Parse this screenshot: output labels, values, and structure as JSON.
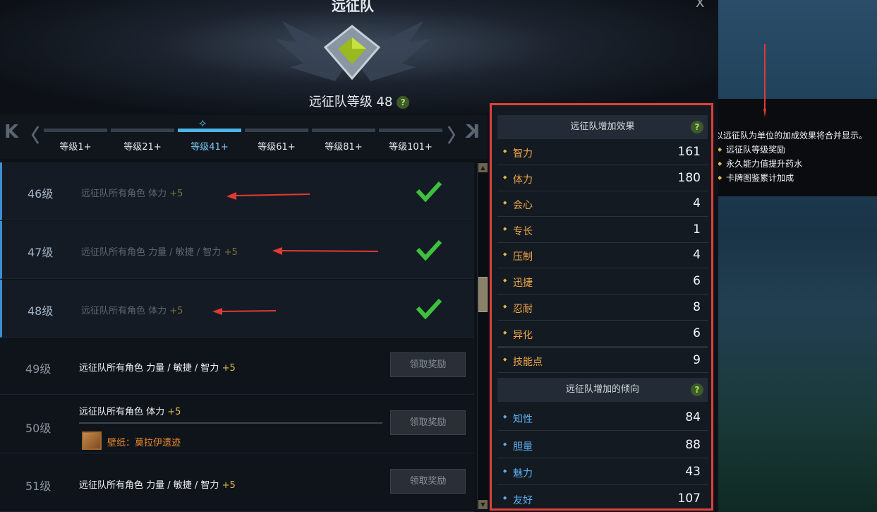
{
  "window": {
    "title": "远征队",
    "close_label": "X"
  },
  "header": {
    "level_text": "远征队等级 48",
    "help": "?"
  },
  "tabs": {
    "first_label": "K",
    "prev_label": "〈",
    "next_label": "〉",
    "last_label": "K",
    "items": [
      {
        "label": "等级1+"
      },
      {
        "label": "等级21+"
      },
      {
        "label": "等级41+"
      },
      {
        "label": "等级61+"
      },
      {
        "label": "等级81+"
      },
      {
        "label": "等级101+"
      }
    ],
    "active_index": 2
  },
  "rows": [
    {
      "level": "46级",
      "desc": "远征队所有角色 体力",
      "bonus": "+5",
      "status": "done"
    },
    {
      "level": "47级",
      "desc": "远征队所有角色 力量 / 敏捷 / 智力",
      "bonus": "+5",
      "status": "done"
    },
    {
      "level": "48级",
      "desc": "远征队所有角色 体力",
      "bonus": "+5",
      "status": "done"
    },
    {
      "level": "49级",
      "desc": "远征队所有角色 力量 / 敏捷 / 智力",
      "bonus": "+5",
      "status": "pending",
      "button": "领取奖励"
    },
    {
      "level": "50级",
      "desc": "远征队所有角色 体力",
      "bonus": "+5",
      "status": "pending",
      "button": "领取奖励",
      "reward": "壁纸：莫拉伊遗迹"
    },
    {
      "level": "51级",
      "desc": "远征队所有角色 力量 / 敏捷 / 智力",
      "bonus": "+5",
      "status": "pending",
      "button": "领取奖励"
    }
  ],
  "effects": {
    "title": "远征队增加效果",
    "help": "?",
    "stats": [
      {
        "name": "智力",
        "value": "161"
      },
      {
        "name": "体力",
        "value": "180"
      },
      {
        "name": "会心",
        "value": "4"
      },
      {
        "name": "专长",
        "value": "1"
      },
      {
        "name": "压制",
        "value": "4"
      },
      {
        "name": "迅捷",
        "value": "6"
      },
      {
        "name": "忍耐",
        "value": "8"
      },
      {
        "name": "异化",
        "value": "6"
      },
      {
        "name": "技能点",
        "value": "9"
      }
    ]
  },
  "tendency": {
    "title": "远征队增加的倾向",
    "help": "?",
    "stats": [
      {
        "name": "知性",
        "value": "84"
      },
      {
        "name": "胆量",
        "value": "88"
      },
      {
        "name": "魅力",
        "value": "43"
      },
      {
        "name": "友好",
        "value": "107"
      }
    ]
  },
  "tooltip": {
    "line1": "以远征队为单位的加成效果将合并显示。",
    "bullets": [
      "远征队等级奖励",
      "永久能力值提升药水",
      "卡牌图鉴累计加成"
    ]
  },
  "colors": {
    "accent_blue": "#4cb4e6",
    "highlight_red": "#e0403a",
    "bonus_gold": "#e0c050",
    "reward_orange": "#f08a30"
  }
}
